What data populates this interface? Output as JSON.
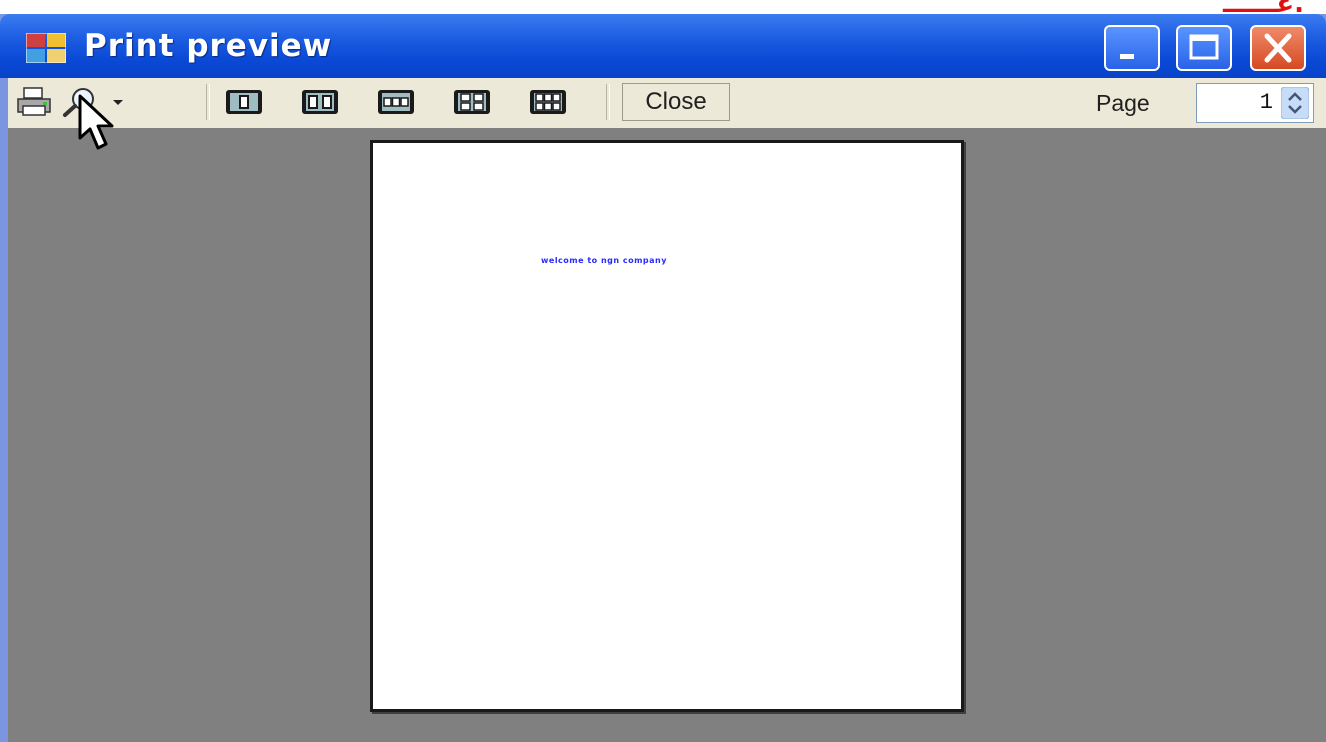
{
  "overlay_text": "عــــــ.",
  "window": {
    "title": "Print preview"
  },
  "toolbar": {
    "close_label": "Close",
    "page_label": "Page",
    "page_value": "1",
    "icons": [
      "printer-icon",
      "zoom-icon",
      "one-page-icon",
      "two-pages-icon",
      "three-pages-icon",
      "four-pages-icon",
      "six-pages-icon"
    ]
  },
  "document": {
    "text": "welcome to ngn company"
  },
  "colors": {
    "title_bar": "#0a4ad6",
    "close_button": "#d44a22",
    "toolbar_bg": "#ece9d8",
    "preview_bg": "#808080",
    "document_text": "#2a2aff"
  }
}
